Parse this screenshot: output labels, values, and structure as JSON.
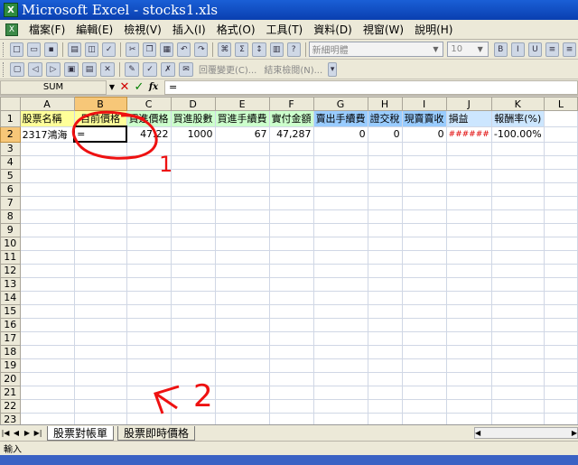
{
  "window": {
    "title": "Microsoft Excel - stocks1.xls"
  },
  "menu": [
    "檔案(F)",
    "編輯(E)",
    "檢視(V)",
    "插入(I)",
    "格式(O)",
    "工具(T)",
    "資料(D)",
    "視窗(W)",
    "說明(H)"
  ],
  "toolbar": {
    "font_name": "新細明體",
    "font_size": "10"
  },
  "reviewbar": {
    "reply_label": "回覆變更(C)...",
    "end_review_label": "結束檢閱(N)..."
  },
  "formula": {
    "namebox": "SUM",
    "cancel_glyph": "✕",
    "enter_glyph": "✓",
    "fx_glyph": "fx",
    "content": "="
  },
  "sheet": {
    "columns": [
      "A",
      "B",
      "C",
      "D",
      "E",
      "F",
      "G",
      "H",
      "I",
      "J",
      "K",
      "L"
    ],
    "headers": [
      "股票名稱",
      "目前價格",
      "買進價格",
      "買進股數",
      "買進手續費",
      "實付金額",
      "賣出手續費",
      "證交稅",
      "現賣賣收",
      "損益",
      "報酬率(%)",
      ""
    ],
    "row2": [
      "2317鴻海",
      "=",
      "47.22",
      "1000",
      "67",
      "47,287",
      "0",
      "0",
      "0",
      "######",
      "-100.00%",
      ""
    ],
    "row_numbers": [
      "1",
      "2",
      "3",
      "4",
      "5",
      "6",
      "7",
      "8",
      "9",
      "10",
      "11",
      "12",
      "13",
      "14",
      "15",
      "16",
      "17",
      "18",
      "19",
      "20",
      "21",
      "22",
      "23"
    ]
  },
  "tabs": [
    {
      "label": "股票對帳單",
      "active": true
    },
    {
      "label": "股票即時價格",
      "active": false
    }
  ],
  "status": {
    "mode": "輸入"
  },
  "annotations": {
    "mark_1": "1",
    "mark_2": "2"
  }
}
